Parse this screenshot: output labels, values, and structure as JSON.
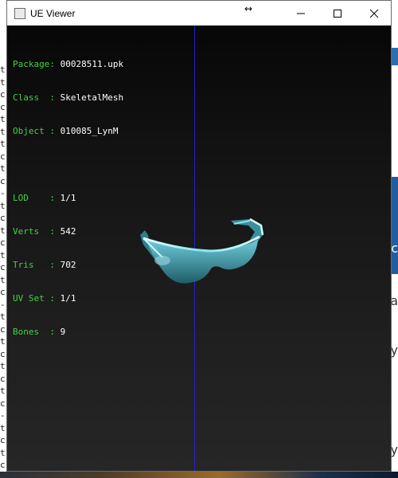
{
  "window": {
    "title": "UE Viewer",
    "icon": "app-icon",
    "resize_glyph": "↔",
    "controls": [
      "minimize-icon",
      "maximize-icon",
      "close-icon"
    ]
  },
  "info": {
    "package_label": "Package:",
    "package_value": "00028511.upk",
    "class_label": "Class  :",
    "class_value": "SkeletalMesh",
    "object_label": "Object :",
    "object_value": "010085_LynM",
    "lod_label": "LOD    :",
    "lod_value": "1/1",
    "verts_label": "Verts  :",
    "verts_value": "542",
    "tris_label": "Tris   :",
    "tris_value": "702",
    "uvset_label": "UV Set :",
    "uvset_value": "1/1",
    "bones_label": "Bones  :",
    "bones_value": "9"
  },
  "colors": {
    "label_green": "#45d045",
    "value_white": "#ffffff",
    "axis_blue": "#2323c8",
    "mesh_cyan": "#57b8c8"
  },
  "background": {
    "left_letters": "t\nt\nc\nc\nt\nt\nt\nc\nt\nc\n-\nt\nc\nt\nc\nt\nc\nt\nc\n-\nt\nc\nt\nc\nt\nc\nt\nc\n-\nt\nc\nt\nc",
    "right_glyphs": [
      "c",
      "ha",
      "y",
      "y"
    ]
  }
}
